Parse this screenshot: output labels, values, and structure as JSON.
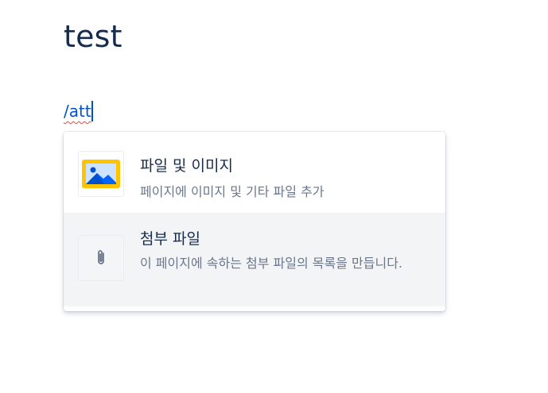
{
  "page": {
    "title": "test"
  },
  "editor": {
    "slash_text": "/att"
  },
  "menu": {
    "items": [
      {
        "title": "파일 및 이미지",
        "description": "페이지에 이미지 및 기타 파일 추가",
        "icon": "image-icon"
      },
      {
        "title": "첨부 파일",
        "description": "이 페이지에 속하는 첨부 파일의 목록을 만듭니다.",
        "icon": "paperclip-icon"
      }
    ]
  },
  "colors": {
    "title": "#172b4d",
    "link": "#0052cc",
    "description": "#6b778c",
    "hover_background": "#f3f4f6",
    "image_frame": "#ffc400",
    "image_sky": "#4c9aff",
    "image_mountain": "#0052cc"
  }
}
